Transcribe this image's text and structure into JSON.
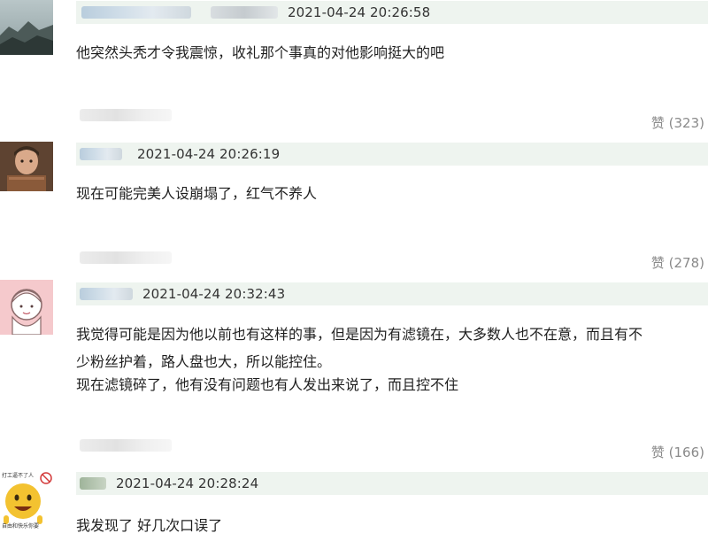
{
  "comments": [
    {
      "timestamp": "2021-04-24 20:26:58",
      "text": "他突然头秃才令我震惊，收礼那个事真的对他影响挺大的吧",
      "likes": "赞 (323)",
      "avatar": "landscape-avatar"
    },
    {
      "timestamp": "2021-04-24 20:26:19",
      "text": "现在可能完美人设崩塌了，红气不养人",
      "likes": "赞 (278)",
      "avatar": "child-photo-avatar"
    },
    {
      "timestamp": "2021-04-24 20:32:43",
      "text_line1": "我觉得可能是因为他以前也有这样的事，但是因为有滤镜在，大多数人也不在意，而且有不",
      "text_line2": "少粉丝护着，路人盘也大，所以能控住。",
      "text_line3": "现在滤镜碎了，他有没有问题也有人发出来说了，而且控不住",
      "likes": "赞 (166)",
      "avatar": "cartoon-girl-avatar"
    },
    {
      "timestamp": "2021-04-24 20:28:24",
      "text": "我发现了 好几次口误了",
      "avatar": "emoji-meme-avatar",
      "avatar_text_top": "打工逼不了人",
      "avatar_text_bottom": "自由和快乐你要"
    }
  ],
  "colors": {
    "header_bar": "#eef4ef",
    "likes_text": "#8a8a8a",
    "avatar_pink": "#f5c9cc",
    "emoji_yellow": "#f3c230"
  }
}
